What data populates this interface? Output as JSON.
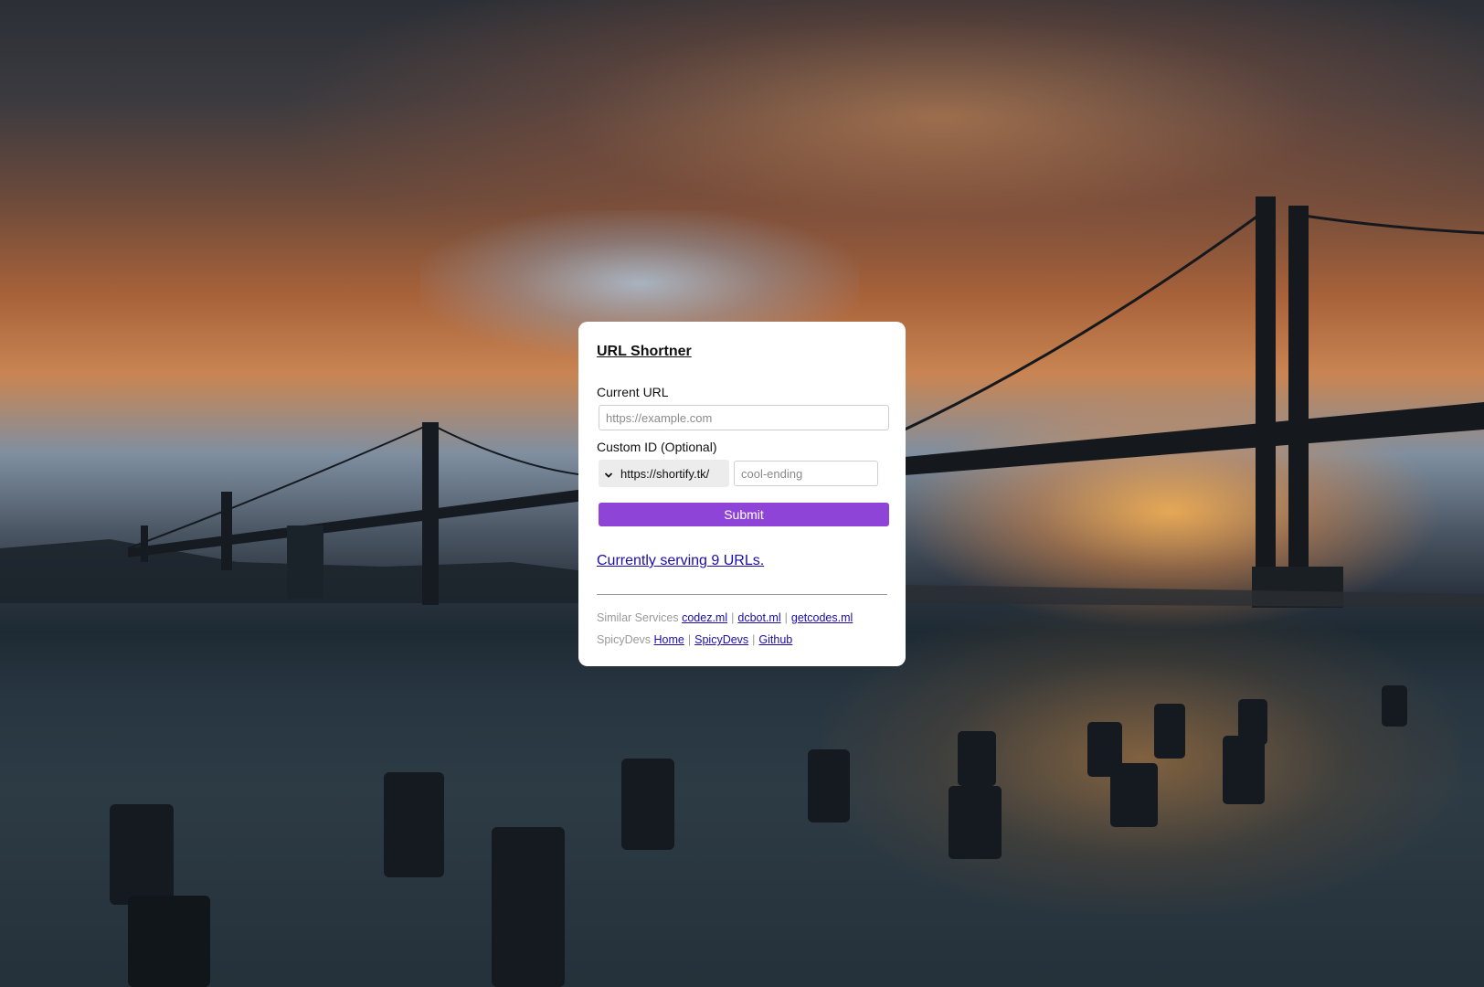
{
  "app": {
    "title": "URL Shortner"
  },
  "form": {
    "current_url_label": "Current URL",
    "current_url_placeholder": "https://example.com",
    "current_url_value": "",
    "custom_id_label": "Custom ID (Optional)",
    "domain_select_value": "https://shortify.tk/",
    "custom_id_placeholder": "cool-ending",
    "custom_id_value": "",
    "submit_label": "Submit"
  },
  "stats": {
    "serving_text": "Currently serving 9 URLs."
  },
  "footer": {
    "similar_label": "Similar Services",
    "similar_links": [
      "codez.ml",
      "dcbot.ml",
      "getcodes.ml"
    ],
    "spicydevs_label": "SpicyDevs",
    "spicydevs_links": [
      "Home",
      "SpicyDevs",
      "Github"
    ],
    "separator": "|"
  },
  "colors": {
    "accent": "#8e44d6",
    "link": "#1a0dab",
    "muted": "#9a9a9a"
  },
  "icons": {
    "select_arrow": "chevron-down-icon"
  }
}
